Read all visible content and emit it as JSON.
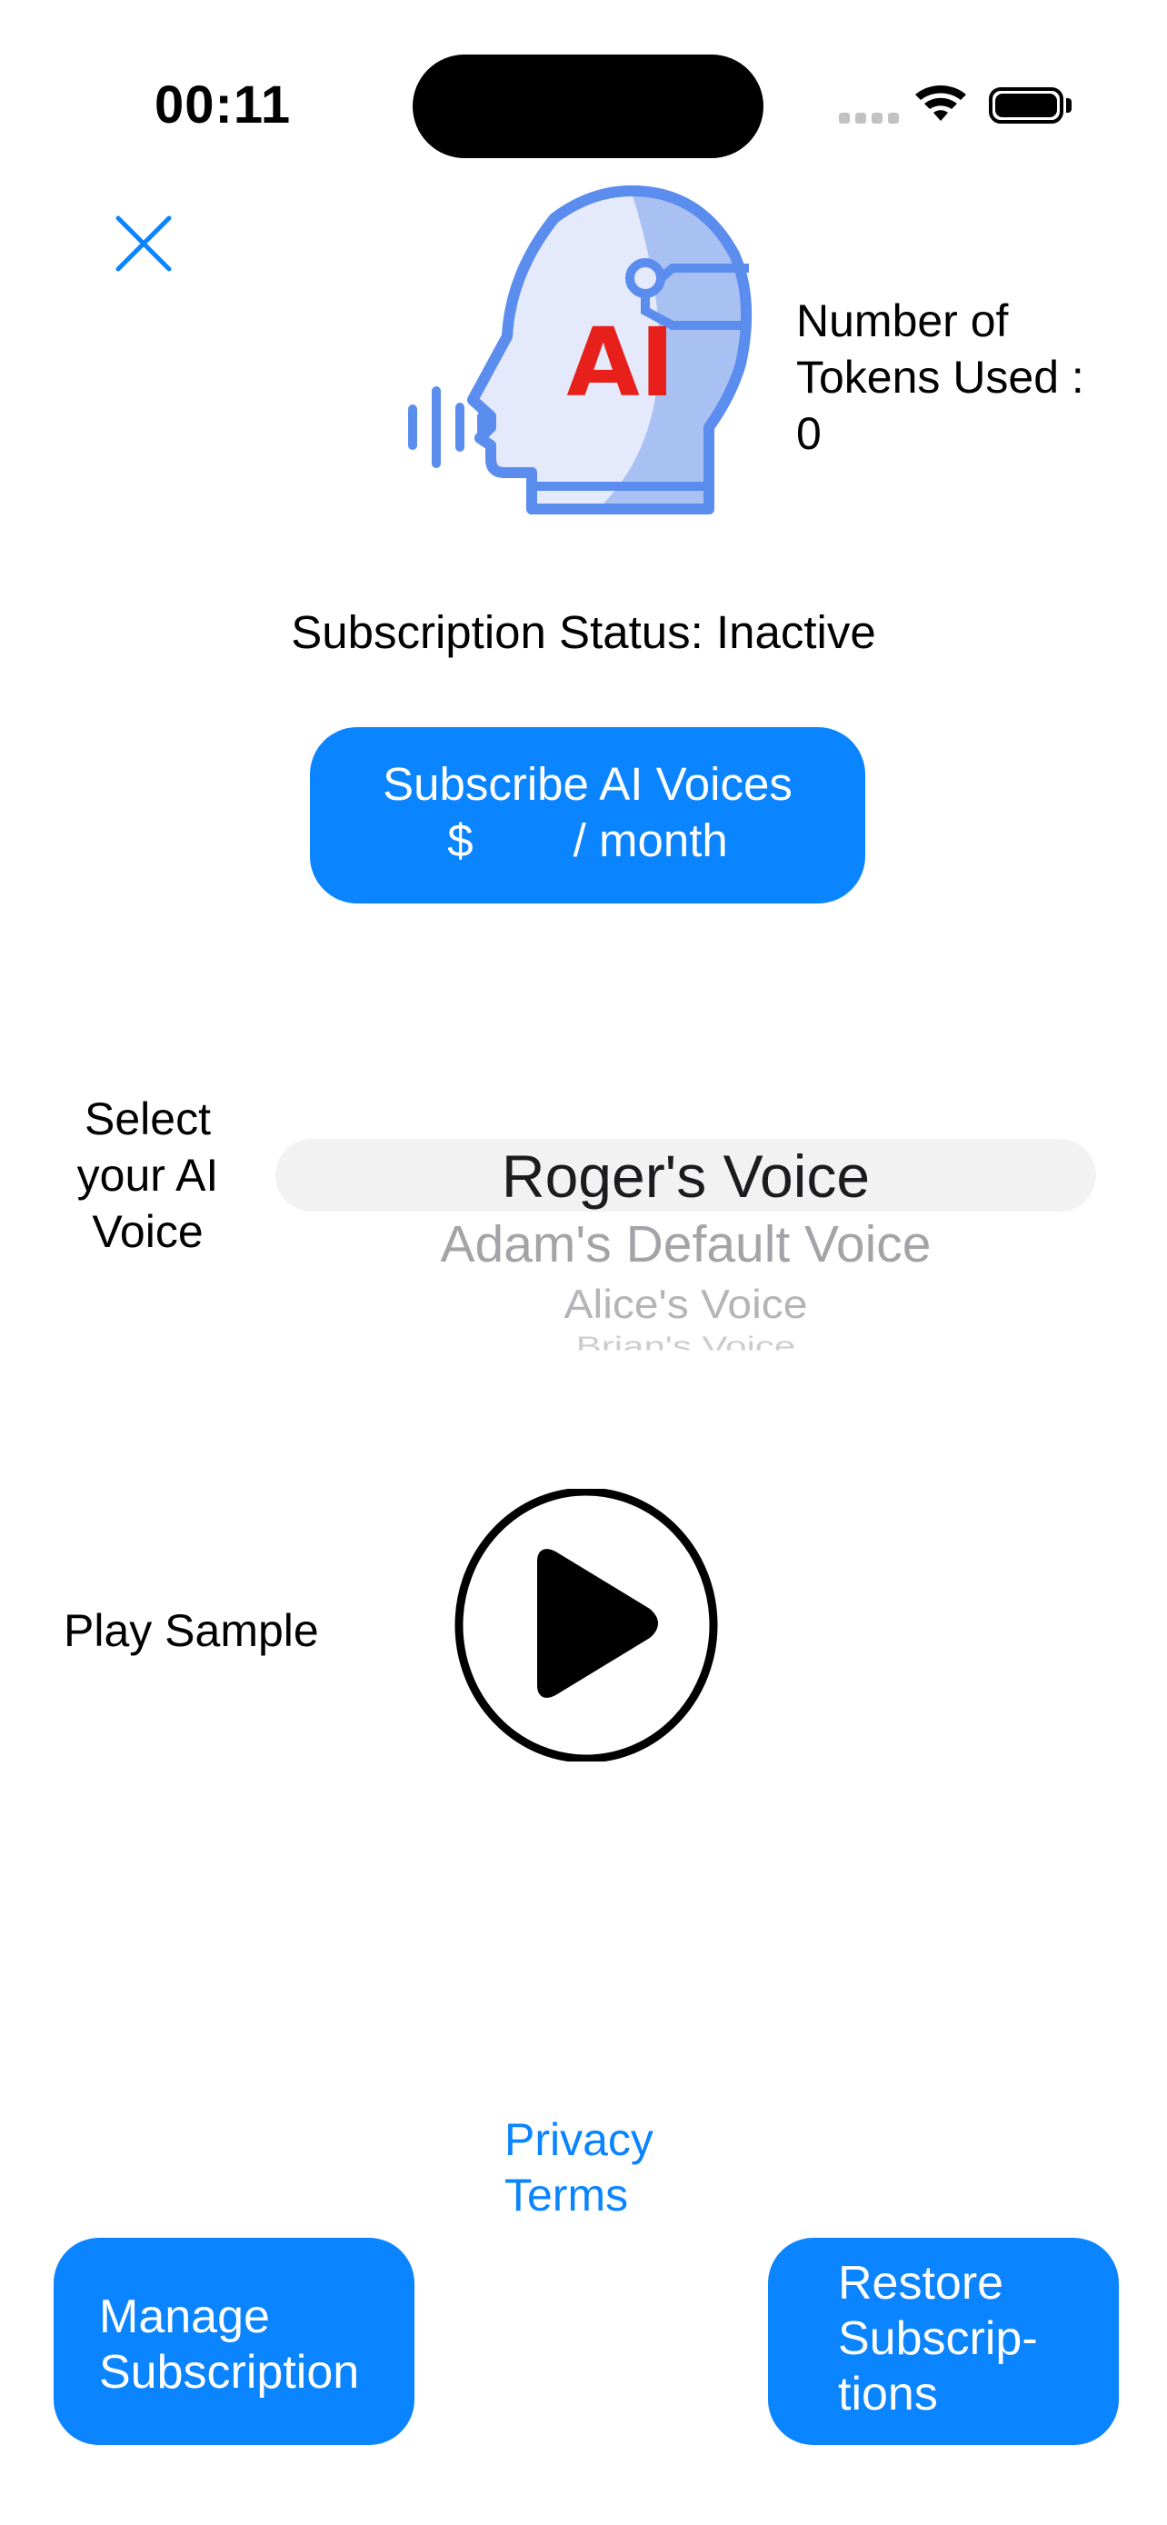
{
  "status_bar": {
    "time": "00:11",
    "wifi_icon": "wifi-icon",
    "battery_icon": "battery-icon",
    "battery_level": 1.0
  },
  "header": {
    "close_icon": "close-icon",
    "logo_text": "AI",
    "tokens_line1": "Number of",
    "tokens_line2": "Tokens Used :",
    "tokens_value": "0"
  },
  "subscription": {
    "status_text": "Subscription Status: Inactive",
    "button_line1": "Subscribe AI Voices",
    "button_currency": "$",
    "button_period": "/ month"
  },
  "voice_picker": {
    "label_line1": "Select",
    "label_line2": "your AI",
    "label_line3": "Voice",
    "options": [
      "Roger's Voice",
      "Adam's Default Voice",
      "Alice's Voice",
      "Brian's Voice"
    ],
    "selected": "Roger's Voice"
  },
  "sample": {
    "label": "Play Sample",
    "play_icon": "play-icon"
  },
  "links": {
    "privacy": "Privacy",
    "terms": "Terms"
  },
  "footer": {
    "manage_line1": "Manage",
    "manage_line2": "Subscription",
    "restore_line1": "Restore",
    "restore_line2": "Subscrip-",
    "restore_line3": "tions"
  },
  "colors": {
    "accent": "#0a84ff",
    "logo_stroke": "#5b8def",
    "logo_fill_light": "#e4eafb",
    "logo_fill_dark": "#a9c0f3",
    "logo_text": "#e8201c"
  }
}
